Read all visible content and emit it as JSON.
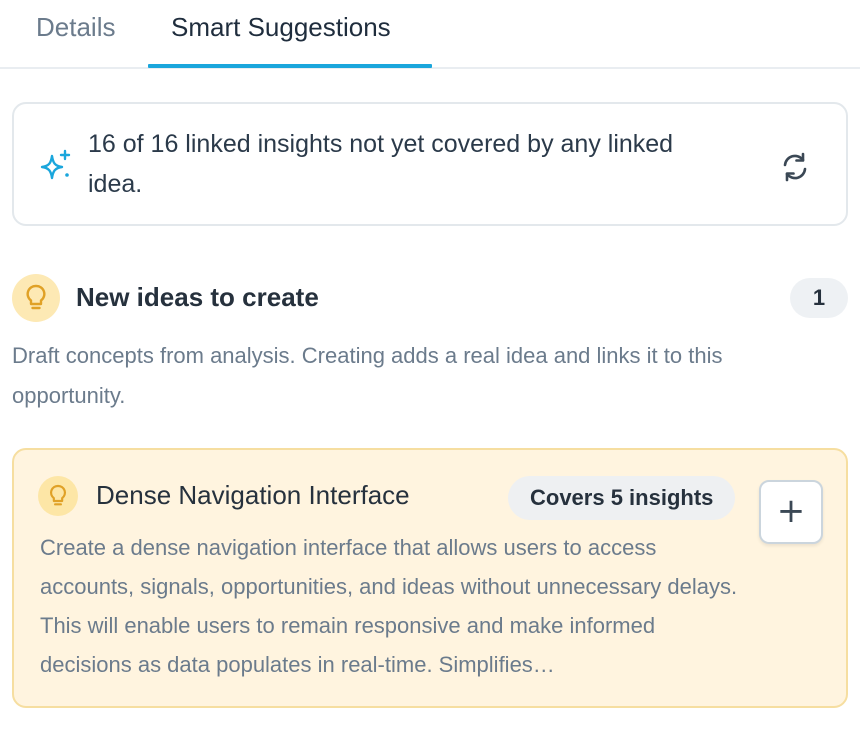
{
  "tabs": [
    {
      "label": "Details",
      "active": false
    },
    {
      "label": "Smart Suggestions",
      "active": true
    }
  ],
  "accent_color": "#1aa6dc",
  "coverage": {
    "message": "16 of 16 linked insights not yet covered by any linked idea.",
    "icon": "sparkle-icon",
    "refresh_icon": "refresh-icon"
  },
  "new_ideas": {
    "title": "New ideas to create",
    "count": "1",
    "description": "Draft concepts from analysis. Creating adds a real idea and links it to this opportunity.",
    "icon": "lightbulb-icon"
  },
  "idea": {
    "title": "Dense Navigation Interface",
    "covers_label": "Covers 5 insights",
    "add_label": "+",
    "description": "Create a dense navigation interface that allows users to access accounts, signals, opportunities, and ideas without unnecessary delays. This will enable users to remain responsive and make informed decisions as data populates in real-time. Simplifies…"
  }
}
